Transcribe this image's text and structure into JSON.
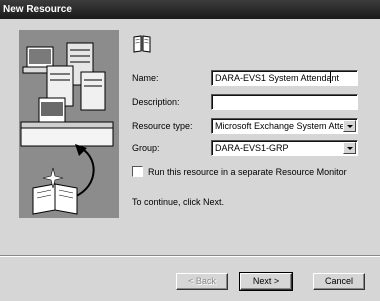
{
  "window": {
    "title": "New Resource"
  },
  "form": {
    "name_label": "Name:",
    "name_value": "DARA-EVS1 System Attendant",
    "description_label": "Description:",
    "description_value": "",
    "resource_type_label": "Resource type:",
    "resource_type_value": "Microsoft Exchange System Atten",
    "group_label": "Group:",
    "group_value": "DARA-EVS1-GRP",
    "separate_monitor_label": "Run this resource in a separate Resource Monitor",
    "separate_monitor_checked": false,
    "continue_text": "To continue, click Next."
  },
  "buttons": {
    "back_label": "< Back",
    "next_label": "Next >",
    "cancel_label": "Cancel"
  },
  "icons": {
    "header": "book-icon",
    "illustration": "server-rack-with-book-illustration"
  }
}
